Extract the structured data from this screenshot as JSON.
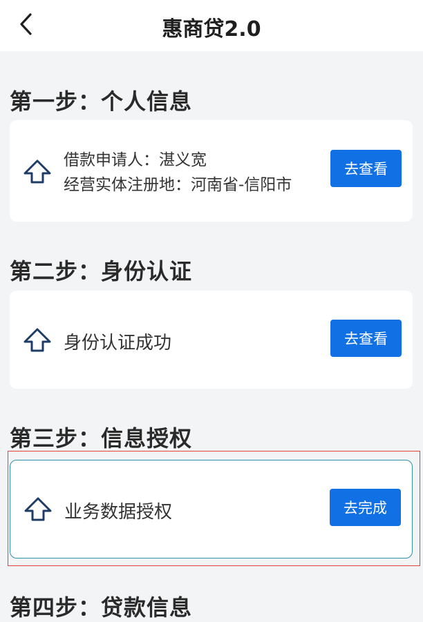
{
  "header": {
    "title": "惠商贷2.0"
  },
  "steps": [
    {
      "title": "第一步：个人信息",
      "lines": [
        "借款申请人：湛义宽",
        "经营实体注册地：河南省-信阳市"
      ],
      "button": "去查看"
    },
    {
      "title": "第二步：身份认证",
      "text": "身份认证成功",
      "button": "去查看"
    },
    {
      "title": "第三步：信息授权",
      "text": "业务数据授权",
      "button": "去完成"
    },
    {
      "title": "第四步：贷款信息"
    }
  ],
  "colors": {
    "accent": "#1170e3",
    "highlight": "#e0403a",
    "icon": "#1f3c66"
  },
  "icons": {
    "back": "chevron-left-icon",
    "step": "upload-arrow-icon"
  }
}
